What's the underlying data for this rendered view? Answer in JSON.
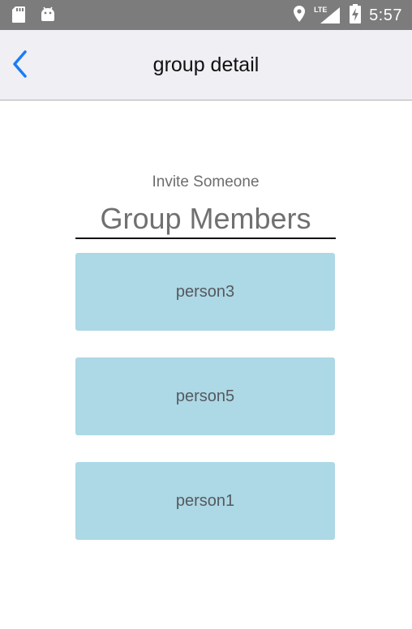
{
  "status_bar": {
    "time": "5:57",
    "network_label": "LTE",
    "icons": [
      "sd-card-icon",
      "android-icon",
      "location-icon",
      "lte-signal-icon",
      "battery-charging-icon"
    ]
  },
  "nav": {
    "title": "group detail",
    "back_icon": "chevron-left-icon",
    "accent_color": "#1a7cf5"
  },
  "invite_label": "Invite Someone",
  "members_header": "Group Members",
  "members": [
    {
      "name": "person3"
    },
    {
      "name": "person5"
    },
    {
      "name": "person1"
    }
  ],
  "colors": {
    "member_card_bg": "#add8e6",
    "nav_bg": "#efeff4",
    "status_bar_bg": "#7c7c7c"
  }
}
